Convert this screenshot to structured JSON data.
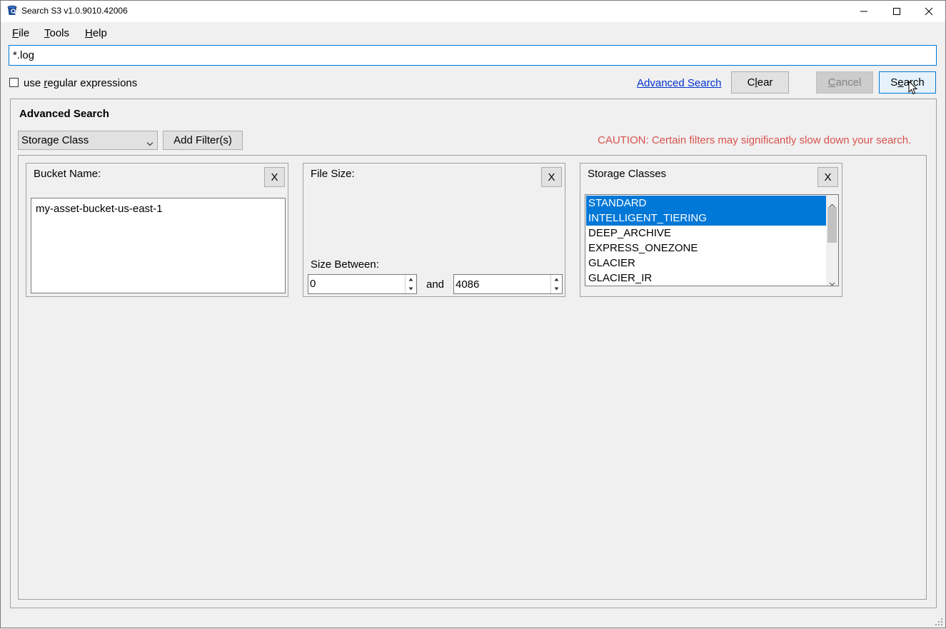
{
  "window": {
    "title": "Search S3 v1.0.9010.42006",
    "controls": [
      "minimize-icon",
      "maximize-icon",
      "close-icon"
    ]
  },
  "menu": {
    "items": [
      {
        "label": "File",
        "mnemonic": "F",
        "rest": "ile"
      },
      {
        "label": "Tools",
        "mnemonic": "T",
        "rest": "ools"
      },
      {
        "label": "Help",
        "mnemonic": "H",
        "rest": "elp"
      }
    ]
  },
  "search": {
    "value": "*.log",
    "use_regex_label_pre": "use ",
    "use_regex_label_mn": "r",
    "use_regex_label_post": "egular expressions",
    "use_regex_checked": false,
    "advanced_link": "Advanced Search",
    "clear_pre": "C",
    "clear_mn": "l",
    "clear_post": "ear",
    "cancel_mn": "C",
    "cancel_post": "ancel",
    "search_pre": "S",
    "search_mn": "e",
    "search_post": "arch"
  },
  "advanced": {
    "title": "Advanced Search",
    "filter_type_selected": "Storage Class",
    "add_filter_label": "Add Filter(s)",
    "caution": "CAUTION: Certain filters may significantly slow down your search.",
    "caution_color": "#d9534f",
    "bucket": {
      "label": "Bucket Name:",
      "remove_label": "X",
      "value": "my-asset-bucket-us-east-1"
    },
    "file_size": {
      "label": "File Size:",
      "remove_label": "X",
      "between_label": "Size Between:",
      "min": "0",
      "and_label": "and",
      "max": "4086"
    },
    "storage_classes": {
      "label": "Storage Classes",
      "remove_label": "X",
      "items": [
        {
          "name": "STANDARD",
          "selected": true
        },
        {
          "name": "INTELLIGENT_TIERING",
          "selected": true
        },
        {
          "name": "DEEP_ARCHIVE",
          "selected": false
        },
        {
          "name": "EXPRESS_ONEZONE",
          "selected": false
        },
        {
          "name": "GLACIER",
          "selected": false
        },
        {
          "name": "GLACIER_IR",
          "selected": false
        }
      ]
    }
  },
  "colors": {
    "accent": "#0078d7",
    "link": "#0033cc",
    "selection": "#0078d7"
  }
}
